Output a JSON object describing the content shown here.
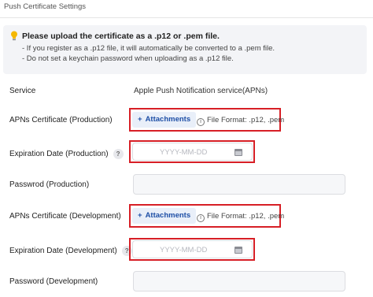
{
  "page": {
    "title": "Push Certificate Settings"
  },
  "notice": {
    "icon": "lightbulb-icon",
    "title": "Please upload the certificate as a .p12 or .pem file.",
    "lines": [
      "- If you register as a .p12 file, it will automatically be converted to a .pem file.",
      "- Do not set a keychain password when uploading as a .p12 file."
    ]
  },
  "form": {
    "service": {
      "label": "Service",
      "value": "Apple Push Notification service(APNs)"
    },
    "apns_prod": {
      "label": "APNs Certificate (Production)",
      "button": "Attachments",
      "format": "File Format: .p12, .pem"
    },
    "exp_prod": {
      "label": "Expiration Date (Production)",
      "help": "?",
      "placeholder": "YYYY-MM-DD"
    },
    "pw_prod": {
      "label": "Passwrod (Production)"
    },
    "apns_dev": {
      "label": "APNs Certificate (Development)",
      "button": "Attachments",
      "format": "File Format: .p12, .pem"
    },
    "exp_dev": {
      "label": "Expiration Date (Development)",
      "help": "?",
      "placeholder": "YYYY-MM-DD"
    },
    "pw_dev": {
      "label": "Password (Development)"
    }
  },
  "colors": {
    "highlight": "#d71f26",
    "accent": "#1e4fa6",
    "notice_bg": "#f3f4f7"
  }
}
